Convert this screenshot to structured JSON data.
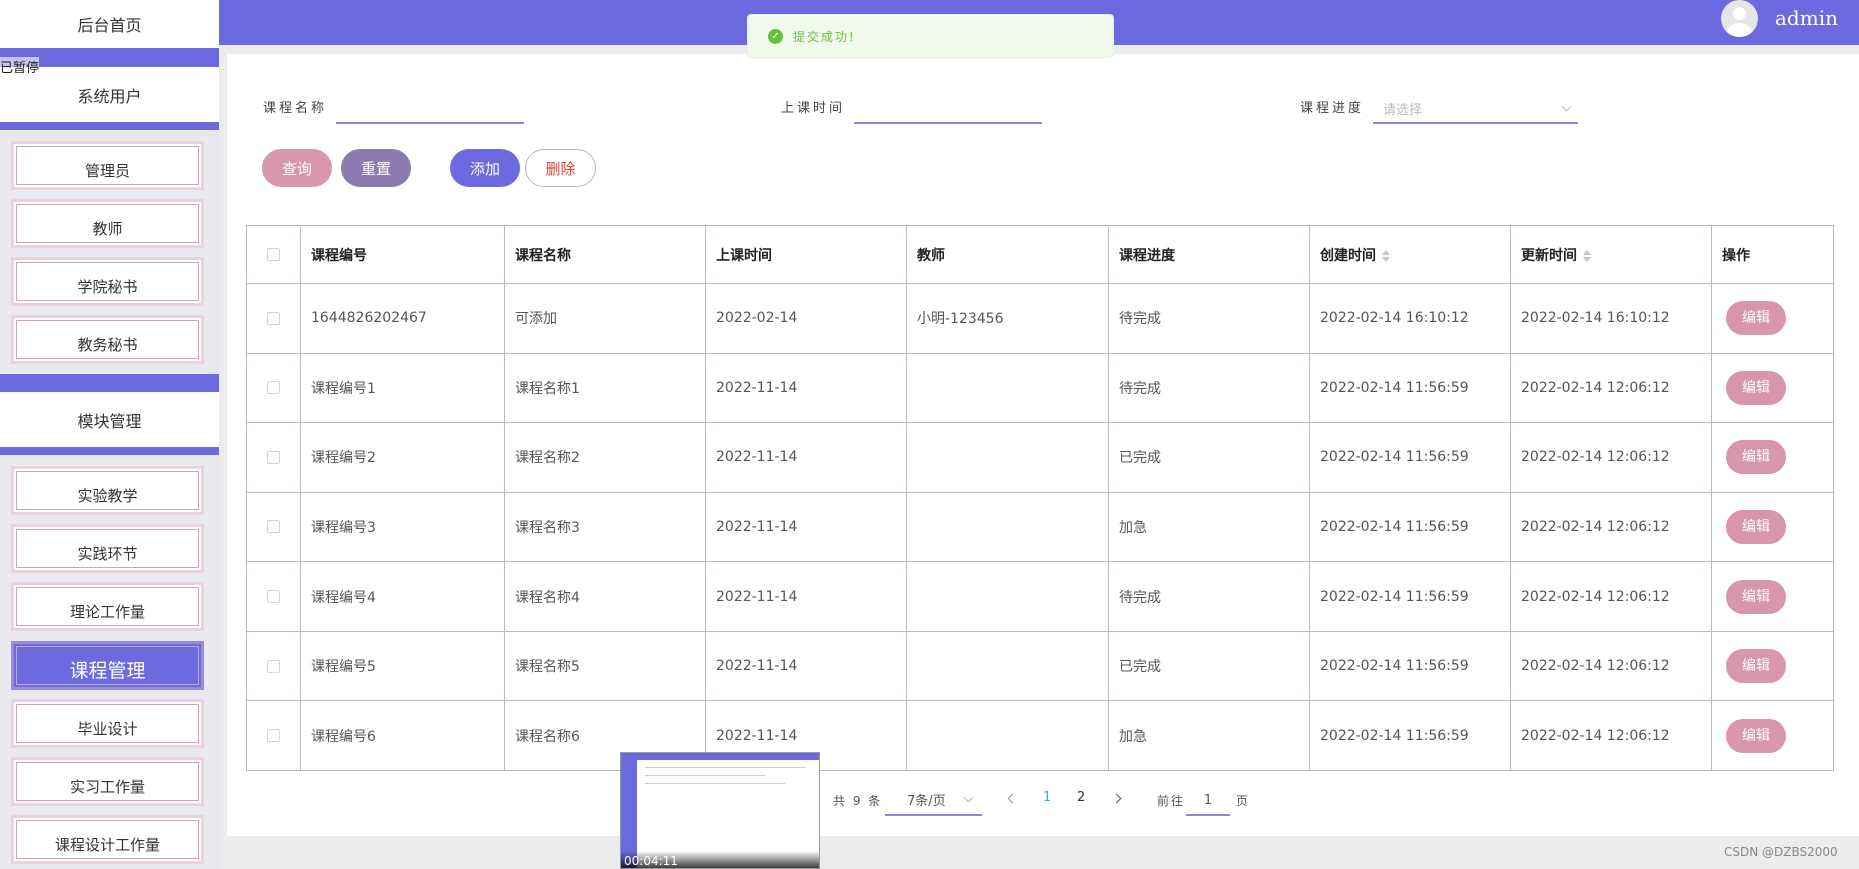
{
  "sidebar": {
    "home": "后台首页",
    "system_users": "系统用户",
    "module_mgmt": "模块管理",
    "user_items": [
      "管理员",
      "教师",
      "学院秘书",
      "教务秘书"
    ],
    "module_items": [
      "实验教学",
      "实践环节",
      "理论工作量",
      "课程管理",
      "毕业设计",
      "实习工作量",
      "课程设计工作量"
    ],
    "active": "课程管理"
  },
  "overlay": {
    "paused": "已暂停",
    "video_time": "00:04:11"
  },
  "header": {
    "username": "admin"
  },
  "toast": {
    "message": "提交成功!"
  },
  "filters": {
    "course_name_label": "课程名称",
    "class_time_label": "上课时间",
    "progress_label": "课程进度",
    "progress_placeholder": "请选择"
  },
  "buttons": {
    "query": "查询",
    "reset": "重置",
    "add": "添加",
    "delete": "删除"
  },
  "colors": {
    "accent": "#6c6ade",
    "pink": "#d896aa",
    "purple_gray": "#8c7bb0",
    "delete_text": "#e0443a"
  },
  "table": {
    "headers": [
      "课程编号",
      "课程名称",
      "上课时间",
      "教师",
      "课程进度",
      "创建时间",
      "更新时间",
      "操作"
    ],
    "edit_label": "编辑",
    "rows": [
      [
        "1644826202467",
        "可添加",
        "2022-02-14",
        "小明-123456",
        "待完成",
        "2022-02-14 16:10:12",
        "2022-02-14 16:10:12"
      ],
      [
        "课程编号1",
        "课程名称1",
        "2022-11-14",
        "",
        "待完成",
        "2022-02-14 11:56:59",
        "2022-02-14 12:06:12"
      ],
      [
        "课程编号2",
        "课程名称2",
        "2022-11-14",
        "",
        "已完成",
        "2022-02-14 11:56:59",
        "2022-02-14 12:06:12"
      ],
      [
        "课程编号3",
        "课程名称3",
        "2022-11-14",
        "",
        "加急",
        "2022-02-14 11:56:59",
        "2022-02-14 12:06:12"
      ],
      [
        "课程编号4",
        "课程名称4",
        "2022-11-14",
        "",
        "待完成",
        "2022-02-14 11:56:59",
        "2022-02-14 12:06:12"
      ],
      [
        "课程编号5",
        "课程名称5",
        "2022-11-14",
        "",
        "已完成",
        "2022-02-14 11:56:59",
        "2022-02-14 12:06:12"
      ],
      [
        "课程编号6",
        "课程名称6",
        "2022-11-14",
        "",
        "加急",
        "2022-02-14 11:56:59",
        "2022-02-14 12:06:12"
      ]
    ]
  },
  "pagination": {
    "total": "共 9 条",
    "page_size": "7条/页",
    "pages": [
      "1",
      "2"
    ],
    "current": "1",
    "goto_label": "前往",
    "goto_value": "1",
    "page_suffix": "页"
  },
  "watermark": "CSDN @DZBS2000"
}
